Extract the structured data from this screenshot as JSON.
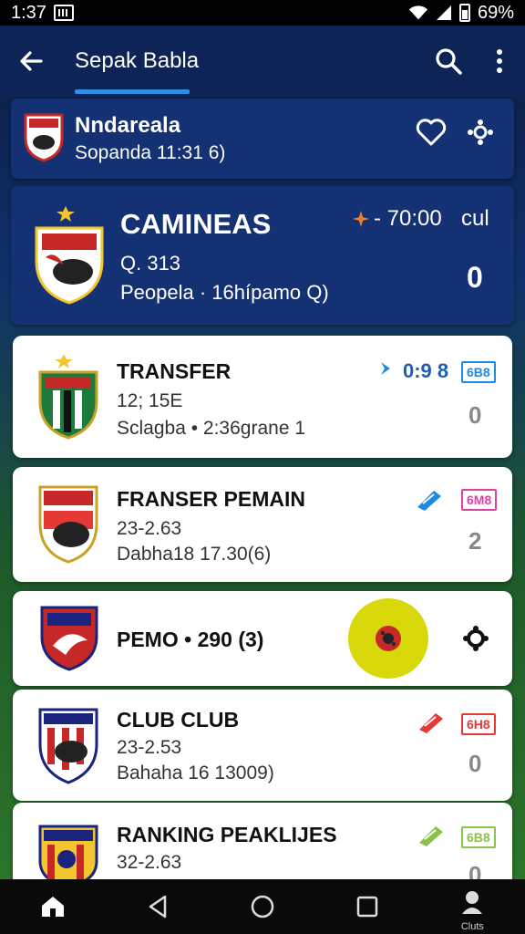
{
  "status": {
    "time": "1:37",
    "battery": "69%"
  },
  "app_bar": {
    "title": "Sepak Babla"
  },
  "team_bar": {
    "name": "Nndareala",
    "sub": "Sopanda 11:31 6)"
  },
  "featured": {
    "title": "CAMINEAS",
    "line1": "Q. 313",
    "line2": "Peopela · 16hípamo Q)",
    "time": "- 70:00",
    "time_suffix": "cul",
    "score": "0"
  },
  "cards": [
    {
      "title": "TRANSFER",
      "line1": "12; 15E",
      "line2": "Sclagba • 2:36grane 1",
      "time": "0:9 8",
      "badge": "6B8",
      "score": "0",
      "accent": "#1e88e5"
    },
    {
      "title": "FRANSER PEMAIN",
      "line1": "23-2.63",
      "line2": "Dabha18 17.30(6)",
      "time": "",
      "badge": "6M8",
      "score": "2",
      "accent": "#e040a0"
    },
    {
      "title": "PEMO • 290 (3)",
      "line1": "",
      "line2": "",
      "time": "",
      "badge": "",
      "score": "",
      "accent": "#d8d80a"
    },
    {
      "title": "CLUB  CLUB",
      "line1": "23-2.53",
      "line2": "Bahaha 16 13009)",
      "time": "",
      "badge": "6H8",
      "score": "0",
      "accent": "#e53935"
    },
    {
      "title": "RANKING PEAKLIJES",
      "line1": "32-2.63",
      "line2": "",
      "time": "",
      "badge": "6B8",
      "score": "0",
      "accent": "#8bc34a"
    }
  ],
  "bottom_nav": {
    "profile_label": "Cluts"
  },
  "colors": {
    "app_bar": "#0e2456",
    "card_dark": "#143173",
    "tab_indicator": "#2f8fe6",
    "highlight": "#d8d80a"
  }
}
